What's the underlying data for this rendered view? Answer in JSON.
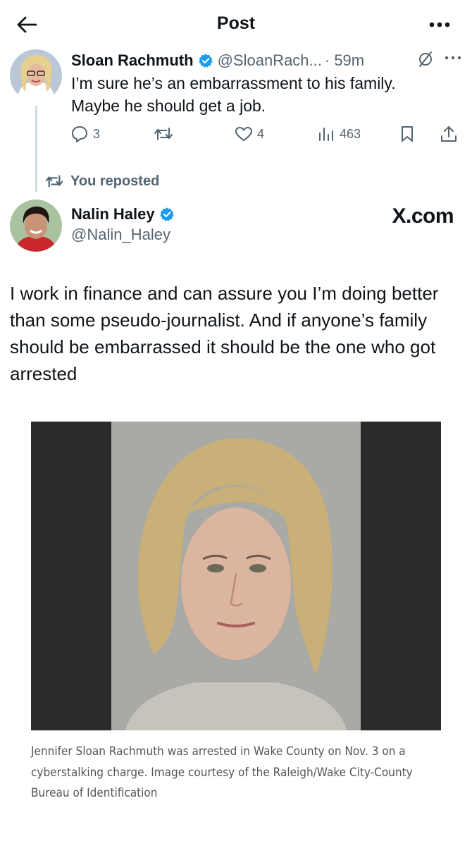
{
  "header": {
    "title": "Post",
    "back_icon": "arrow-left-icon",
    "more_icon": "more-horizontal-icon"
  },
  "reply_tweet": {
    "author_name": "Sloan Rachmuth",
    "handle": "@SloanRach...",
    "time": "· 59m",
    "text_lines": [
      "I’m sure he’s an embarrassment to his family.",
      "Maybe he should get a job."
    ],
    "actions": {
      "replies": "3",
      "reposts": "",
      "likes": "4",
      "views": "463"
    }
  },
  "repost_note": "You reposted",
  "main_tweet": {
    "author_name": "Nalin Haley",
    "handle": "@Nalin_Haley",
    "watermark": "X.com",
    "text": "I work in finance and can assure you I’m doing better than some pseudo-journalist. And if anyone’s family should be embarrassed it should be the one who got arrested"
  },
  "photo": {
    "caption_lines": [
      "Jennifer Sloan Rachmuth was arrested in Wake County on Nov. 3 on a",
      "cyberstalking charge. Image courtesy of the Raleigh/Wake City-County",
      "Bureau of Identification"
    ]
  },
  "colors": {
    "text": "#0f1419",
    "secondary": "#536471",
    "verified_blue": "#1d9bf0",
    "thread_line": "#cfd9de"
  }
}
